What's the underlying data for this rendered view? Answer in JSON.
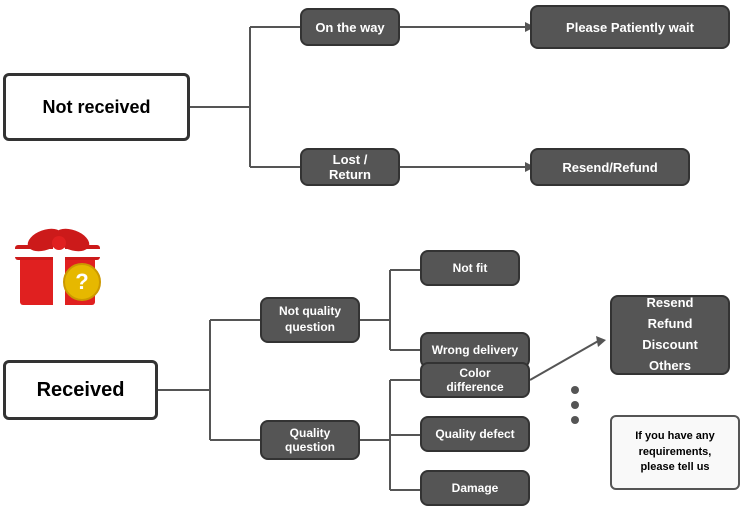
{
  "boxes": {
    "not_received": {
      "label": "Not received"
    },
    "on_the_way": {
      "label": "On the way"
    },
    "please_wait": {
      "label": "Please Patiently wait"
    },
    "lost_return": {
      "label": "Lost / Return"
    },
    "resend_refund_top": {
      "label": "Resend/Refund"
    },
    "received": {
      "label": "Received"
    },
    "not_quality": {
      "label": "Not quality\nquestion"
    },
    "quality_question": {
      "label": "Quality question"
    },
    "not_fit": {
      "label": "Not fit"
    },
    "wrong_delivery": {
      "label": "Wrong delivery"
    },
    "color_diff": {
      "label": "Color difference"
    },
    "quality_defect": {
      "label": "Quality defect"
    },
    "damage": {
      "label": "Damage"
    },
    "resend_refund_right": {
      "label": "Resend\nRefund\nDiscount\nOthers"
    },
    "if_requirements": {
      "label": "If you have any\nrequirements,\nplease tell us"
    }
  }
}
